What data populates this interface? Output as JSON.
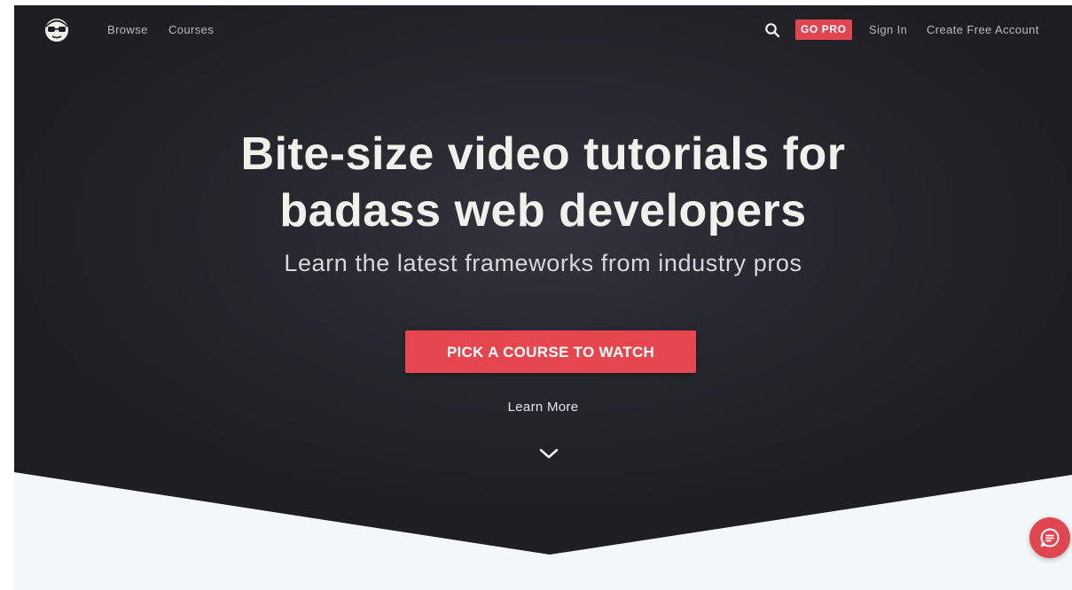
{
  "nav": {
    "logo_icon": "nerd-mascot-logo-icon",
    "browse_label": "Browse",
    "courses_label": "Courses",
    "search_icon": "search-icon",
    "go_pro_label": "GO PRO",
    "sign_in_label": "Sign In",
    "create_account_label": "Create Free Account"
  },
  "hero": {
    "headline_line1": "Bite-size video tutorials for",
    "headline_line2": "badass web developers",
    "subheadline": "Learn the latest frameworks from industry pros",
    "cta_label": "PICK A COURSE TO WATCH",
    "learn_more_label": "Learn More",
    "scroll_icon": "chevron-down-icon"
  },
  "chat": {
    "icon": "chat-bubble-icon"
  },
  "colors": {
    "accent": "#e6474f",
    "hero_background": "#25252b",
    "page_background": "#f4f7fa"
  }
}
